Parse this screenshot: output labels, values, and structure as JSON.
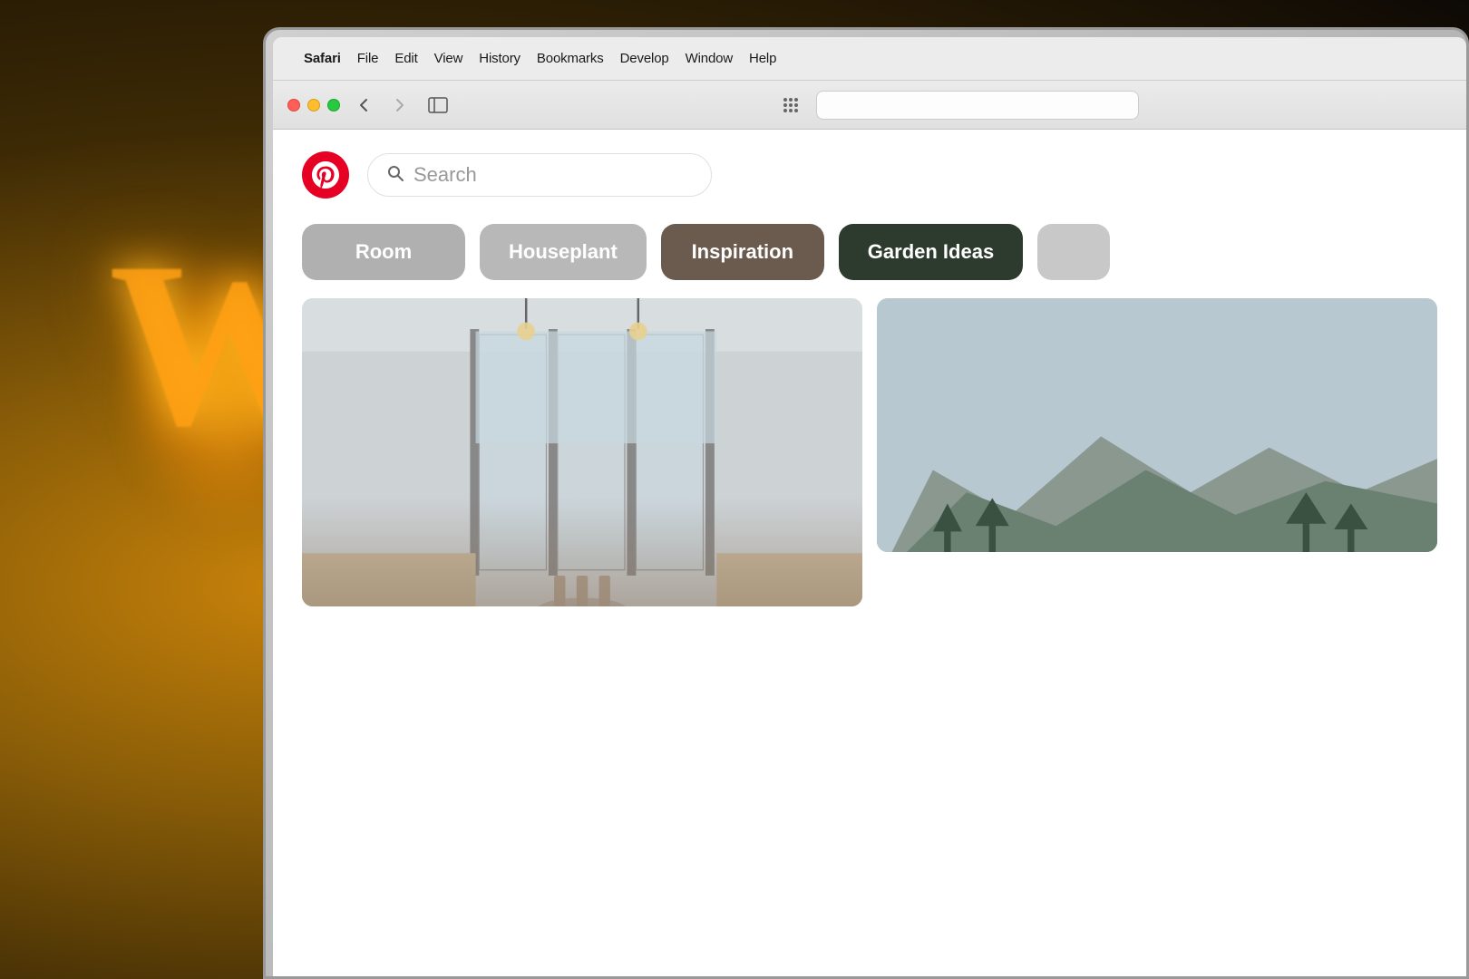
{
  "scene": {
    "background_color": "#1a1008"
  },
  "menubar": {
    "apple_symbol": "",
    "items": [
      {
        "label": "Safari",
        "bold": true
      },
      {
        "label": "File",
        "bold": false
      },
      {
        "label": "Edit",
        "bold": false
      },
      {
        "label": "View",
        "bold": false
      },
      {
        "label": "History",
        "bold": false
      },
      {
        "label": "Bookmarks",
        "bold": false
      },
      {
        "label": "Develop",
        "bold": false
      },
      {
        "label": "Window",
        "bold": false
      },
      {
        "label": "Help",
        "bold": false
      }
    ]
  },
  "safari_toolbar": {
    "traffic_lights": {
      "red_label": "close",
      "yellow_label": "minimize",
      "green_label": "maximize"
    },
    "back_button": "‹",
    "forward_button": "›",
    "sidebar_icon": "⊡",
    "grid_icon": "⠿"
  },
  "pinterest": {
    "logo_alt": "Pinterest logo",
    "search_placeholder": "Search",
    "categories": [
      {
        "label": "Room",
        "style": "room"
      },
      {
        "label": "Houseplant",
        "style": "houseplant"
      },
      {
        "label": "Inspiration",
        "style": "inspiration"
      },
      {
        "label": "Garden Ideas",
        "style": "garden"
      }
    ],
    "images": [
      {
        "alt": "Modern kitchen with bifold glass doors",
        "type": "kitchen"
      },
      {
        "alt": "Mountain landscape with trees",
        "type": "mountain"
      }
    ]
  }
}
